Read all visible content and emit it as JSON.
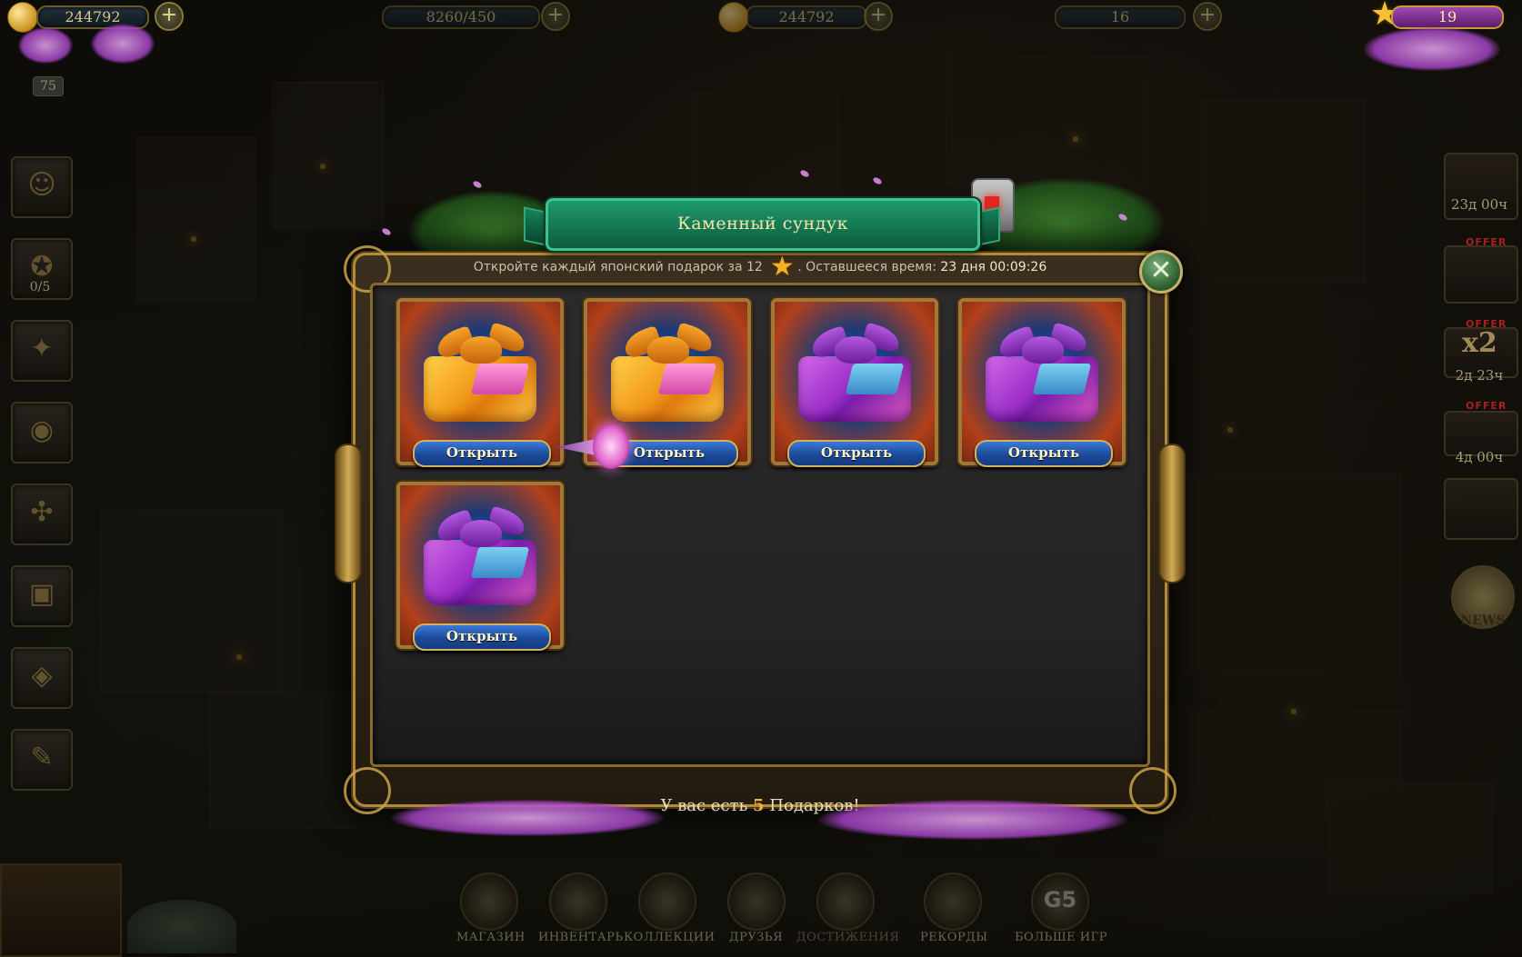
{
  "hud": {
    "coins": "244792",
    "energy": "8260/450",
    "coins_center": "244792",
    "gems": "16",
    "stars": "19",
    "level": "75",
    "plus_icon": "plus-icon"
  },
  "sidebar_left": {
    "quest_progress": "0/5"
  },
  "sidebar_right": {
    "timer_1": "23д 00ч",
    "offer_label": "OFFER",
    "multiplier": "x2",
    "timer_2": "2д 23ч",
    "timer_3": "4д 00ч",
    "news_label": "NEWS"
  },
  "dialog": {
    "title": "Каменный сундук",
    "subtitle_prefix": "Откройте каждый японский подарок за 12",
    "subtitle_suffix": ". Оставшееся время:",
    "time_remaining": "23 дня 00:09:26",
    "footer_prefix": "У вас есть",
    "gift_count": "5",
    "footer_suffix": "Подарков!",
    "gifts": [
      {
        "color": "gold",
        "button": "Открыть"
      },
      {
        "color": "gold",
        "button": "Открыть"
      },
      {
        "color": "purple",
        "button": "Открыть"
      },
      {
        "color": "purple",
        "button": "Открыть"
      },
      {
        "color": "purple",
        "button": "Открыть"
      }
    ]
  },
  "dock": {
    "shop": "МАГАЗИН",
    "inventory": "ИНВЕНТАРЬ",
    "collections": "КОЛЛЕКЦИИ",
    "friends": "ДРУЗЬЯ",
    "achievements": "ДОСТИЖЕНИЯ",
    "records": "РЕКОРДЫ",
    "more_games": "БОЛЬШЕ ИГР",
    "g5_logo": "G5"
  },
  "colors": {
    "accent_gold": "#f0b43a",
    "banner_green": "#1f9a6c",
    "button_blue": "#1c4a9a"
  }
}
